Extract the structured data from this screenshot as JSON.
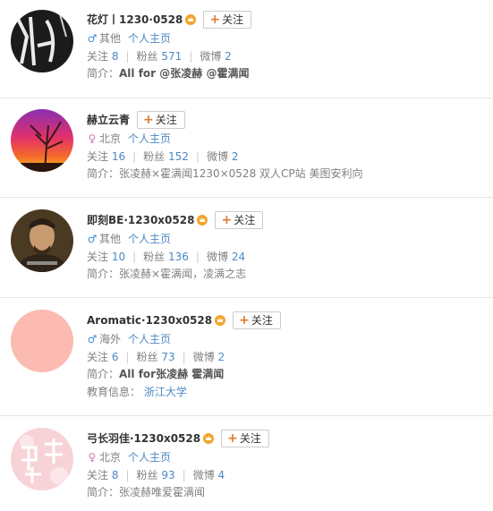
{
  "labels": {
    "follow": "关注",
    "homepage": "个人主页",
    "following": "关注",
    "fans": "粉丝",
    "weibo": "微博",
    "intro": "简介：",
    "edu": "教育信息："
  },
  "colors": {
    "link": "#4d88c2",
    "follow_plus": "#e07a2c",
    "male": "#3b8ed6",
    "female": "#d17ab4",
    "vip_badge": "#f2a52b"
  },
  "users": [
    {
      "name": "花灯丨1230·0528",
      "gender": "male",
      "gender_icon": "♂",
      "location": "其他",
      "following": "8",
      "fans": "571",
      "weibo": "2",
      "intro": "All for @张凌赫 @霍满闻"
    },
    {
      "name": "赫立云青",
      "gender": "female",
      "gender_icon": "♀",
      "location": "北京",
      "following": "16",
      "fans": "152",
      "weibo": "2",
      "intro": "张凌赫×霍满闻1230×0528 双人CP站 美图安利向"
    },
    {
      "name": "即刻BE·1230x0528",
      "gender": "male",
      "gender_icon": "♂",
      "location": "其他",
      "following": "10",
      "fans": "136",
      "weibo": "24",
      "intro": "张凌赫×霍满闻，凌满之志"
    },
    {
      "name": "Aromatic·1230x0528",
      "gender": "male",
      "gender_icon": "♂",
      "location": "海外",
      "following": "6",
      "fans": "73",
      "weibo": "2",
      "intro": "All for张凌赫 霍满闻",
      "edu": "浙江大学"
    },
    {
      "name": "弓长羽佳·1230x0528",
      "gender": "female",
      "gender_icon": "♀",
      "location": "北京",
      "following": "8",
      "fans": "93",
      "weibo": "4",
      "intro": "张凌赫唯爱霍满闻"
    }
  ]
}
